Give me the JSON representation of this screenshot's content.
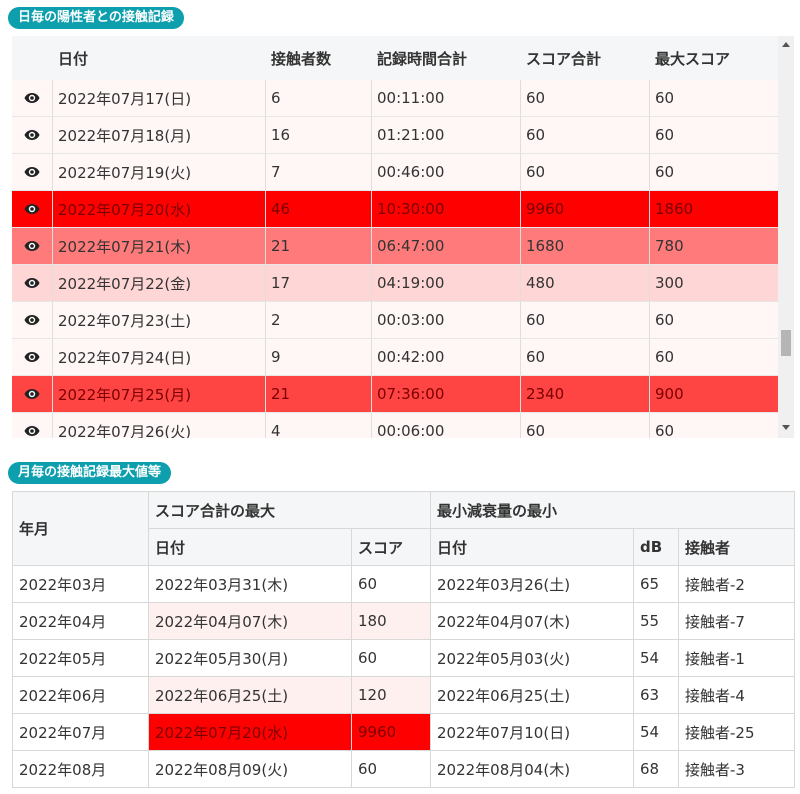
{
  "daily_section": {
    "title": "日毎の陽性者との接触記録",
    "columns": [
      "日付",
      "接触者数",
      "記録時間合計",
      "スコア合計",
      "最大スコア"
    ],
    "rows": [
      {
        "date": "2022年07月17(日)",
        "count": "6",
        "time": "00:11:00",
        "score_sum": "60",
        "max_score": "60",
        "level": 0
      },
      {
        "date": "2022年07月18(月)",
        "count": "16",
        "time": "01:21:00",
        "score_sum": "60",
        "max_score": "60",
        "level": 0
      },
      {
        "date": "2022年07月19(火)",
        "count": "7",
        "time": "00:46:00",
        "score_sum": "60",
        "max_score": "60",
        "level": 0
      },
      {
        "date": "2022年07月20(水)",
        "count": "46",
        "time": "10:30:00",
        "score_sum": "9960",
        "max_score": "1860",
        "level": 3
      },
      {
        "date": "2022年07月21(木)",
        "count": "21",
        "time": "06:47:00",
        "score_sum": "1680",
        "max_score": "780",
        "level": 2
      },
      {
        "date": "2022年07月22(金)",
        "count": "17",
        "time": "04:19:00",
        "score_sum": "480",
        "max_score": "300",
        "level": 1
      },
      {
        "date": "2022年07月23(土)",
        "count": "2",
        "time": "00:03:00",
        "score_sum": "60",
        "max_score": "60",
        "level": 0
      },
      {
        "date": "2022年07月24(日)",
        "count": "9",
        "time": "00:42:00",
        "score_sum": "60",
        "max_score": "60",
        "level": 0
      },
      {
        "date": "2022年07月25(月)",
        "count": "21",
        "time": "07:36:00",
        "score_sum": "2340",
        "max_score": "900",
        "level": 4
      },
      {
        "date": "2022年07月26(火)",
        "count": "4",
        "time": "00:06:00",
        "score_sum": "60",
        "max_score": "60",
        "level": 0
      }
    ],
    "row_icon": "eye-icon"
  },
  "monthly_section": {
    "title": "月毎の接触記録最大値等",
    "header": {
      "year_month": "年月",
      "score_group": "スコア合計の最大",
      "atten_group": "最小減衰量の最小",
      "date": "日付",
      "score": "スコア",
      "date2": "日付",
      "db": "dB",
      "contact": "接触者"
    },
    "rows": [
      {
        "ym": "2022年03月",
        "score_date": "2022年03月31(木)",
        "score": "60",
        "atten_date": "2022年03月26(土)",
        "db": "65",
        "contact": "接触者-2",
        "level": 0
      },
      {
        "ym": "2022年04月",
        "score_date": "2022年04月07(木)",
        "score": "180",
        "atten_date": "2022年04月07(木)",
        "db": "55",
        "contact": "接触者-7",
        "level": 1
      },
      {
        "ym": "2022年05月",
        "score_date": "2022年05月30(月)",
        "score": "60",
        "atten_date": "2022年05月03(火)",
        "db": "54",
        "contact": "接触者-1",
        "level": 0
      },
      {
        "ym": "2022年06月",
        "score_date": "2022年06月25(土)",
        "score": "120",
        "atten_date": "2022年06月25(土)",
        "db": "63",
        "contact": "接触者-4",
        "level": 1
      },
      {
        "ym": "2022年07月",
        "score_date": "2022年07月20(水)",
        "score": "9960",
        "atten_date": "2022年07月10(日)",
        "db": "54",
        "contact": "接触者-25",
        "level": 3
      },
      {
        "ym": "2022年08月",
        "score_date": "2022年08月09(火)",
        "score": "60",
        "atten_date": "2022年08月04(木)",
        "db": "68",
        "contact": "接触者-3",
        "level": 0
      }
    ]
  },
  "colors": {
    "badge": "#0d9fae",
    "level0": "#fff6f6",
    "level1": "#ffd6d6",
    "level2": "#ff7a7a",
    "level3": "#ff0000",
    "level4": "#ff4444",
    "monthly_level1": "#fff0f0"
  }
}
